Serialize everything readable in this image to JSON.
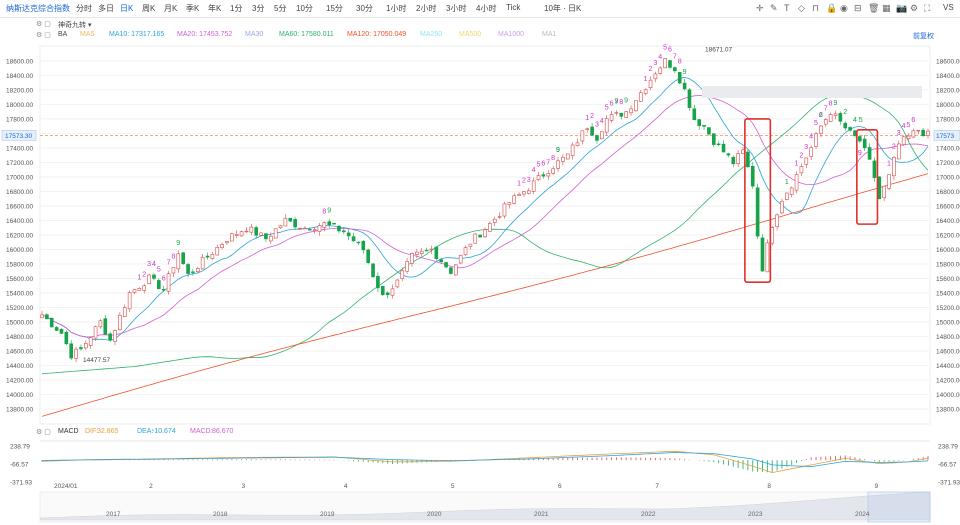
{
  "toolbar": {
    "title": "纳斯达克综合指数",
    "periods": [
      "分时",
      "多日",
      "日K",
      "周K",
      "月K",
      "季K",
      "年K",
      "1分",
      "3分",
      "5分",
      "10分",
      "15分",
      "30分",
      "1小时",
      "2小时",
      "3小时",
      "4小时",
      "Tick",
      "10年 · 日K"
    ],
    "active_period": "日K",
    "right_label": "VS",
    "icons": [
      "crosshair-icon",
      "draw-icon",
      "text-icon",
      "shape-icon",
      "magnet-icon",
      "lock-icon",
      "eye-icon",
      "ruler-icon",
      "trash-icon",
      "layout-icon",
      "camera-icon",
      "settings-icon",
      "fullscreen-icon"
    ]
  },
  "legend": {
    "strategy_label": "神奇九转",
    "ba_label": "BA",
    "mas": [
      {
        "label": "MA5",
        "value": "",
        "color": "#e8b86a"
      },
      {
        "label": "MA10",
        "value": "17317.165",
        "color": "#2ba3d9"
      },
      {
        "label": "MA20",
        "value": "17453.752",
        "color": "#d35fd3"
      },
      {
        "label": "MA30",
        "value": "",
        "color": "#9aa4e8"
      },
      {
        "label": "MA60",
        "value": "17580.011",
        "color": "#2fb36b"
      },
      {
        "label": "MA120",
        "value": "17050.049",
        "color": "#f0502a"
      },
      {
        "label": "MA250",
        "value": "",
        "color": "#8fe6f0"
      },
      {
        "label": "MA500",
        "value": "",
        "color": "#e8d86a"
      },
      {
        "label": "MA1000",
        "value": "",
        "color": "#c9a0e8"
      },
      {
        "label": "MA1",
        "value": "",
        "color": "#bbbbbb"
      }
    ],
    "right_link": "前复权"
  },
  "macd_legend": {
    "name": "MACD",
    "dif_label": "DIF:",
    "dif_value": "32.865",
    "dea_label": "DEA:",
    "dea_value": "-10.674",
    "macd_label": "MACD:",
    "macd_value": "86.670"
  },
  "current_price": "17573.30",
  "annotations": {
    "high": "18671.07",
    "low": "14477.57"
  },
  "chart_data": {
    "type": "candlestick",
    "y_ticks": [
      "18600.00",
      "18400.00",
      "18200.00",
      "18000.00",
      "17800.00",
      "17600.00",
      "17400.00",
      "17200.00",
      "17000.00",
      "16800.00",
      "16600.00",
      "16400.00",
      "16200.00",
      "16000.00",
      "15800.00",
      "15600.00",
      "15400.00",
      "15200.00",
      "15000.00",
      "14800.00",
      "14600.00",
      "14400.00",
      "14200.00",
      "14000.00",
      "13800.00"
    ],
    "ylim": [
      13650,
      18750
    ],
    "macd_ticks": [
      "238.79",
      "-66.57",
      "-371.93"
    ],
    "macd_ylim": [
      -420,
      290
    ],
    "month_labels": [
      {
        "label": "2024/01",
        "index": 0
      },
      {
        "label": "2",
        "index": 22
      },
      {
        "label": "3",
        "index": 41
      },
      {
        "label": "4",
        "index": 62
      },
      {
        "label": "5",
        "index": 84
      },
      {
        "label": "6",
        "index": 106
      },
      {
        "label": "7",
        "index": 126
      },
      {
        "label": "8",
        "index": 149
      },
      {
        "label": "9",
        "index": 171
      }
    ],
    "years": [
      "2017",
      "2018",
      "2019",
      "2020",
      "2021",
      "2022",
      "2023",
      "2024"
    ],
    "anchors": [
      [
        0,
        15100
      ],
      [
        4,
        14850
      ],
      [
        6,
        14550
      ],
      [
        8,
        14620
      ],
      [
        12,
        15000
      ],
      [
        14,
        14750
      ],
      [
        18,
        15400
      ],
      [
        22,
        15600
      ],
      [
        25,
        15450
      ],
      [
        28,
        15950
      ],
      [
        30,
        15650
      ],
      [
        34,
        15900
      ],
      [
        38,
        16150
      ],
      [
        42,
        16300
      ],
      [
        46,
        16150
      ],
      [
        50,
        16400
      ],
      [
        54,
        16300
      ],
      [
        58,
        16350
      ],
      [
        62,
        16250
      ],
      [
        66,
        16000
      ],
      [
        68,
        15650
      ],
      [
        70,
        15350
      ],
      [
        73,
        15550
      ],
      [
        76,
        15900
      ],
      [
        80,
        16000
      ],
      [
        84,
        15700
      ],
      [
        88,
        16100
      ],
      [
        92,
        16350
      ],
      [
        96,
        16650
      ],
      [
        100,
        16850
      ],
      [
        104,
        17100
      ],
      [
        108,
        17300
      ],
      [
        112,
        17700
      ],
      [
        114,
        17550
      ],
      [
        116,
        17800
      ],
      [
        120,
        17900
      ],
      [
        124,
        18250
      ],
      [
        126,
        18450
      ],
      [
        128,
        18600
      ],
      [
        130,
        18500
      ],
      [
        132,
        18200
      ],
      [
        134,
        17800
      ],
      [
        136,
        17700
      ],
      [
        138,
        17500
      ],
      [
        140,
        17350
      ],
      [
        142,
        17200
      ],
      [
        144,
        17350
      ],
      [
        146,
        16900
      ],
      [
        147,
        16200
      ],
      [
        148,
        15750
      ],
      [
        150,
        16350
      ],
      [
        152,
        16700
      ],
      [
        154,
        16900
      ],
      [
        156,
        17150
      ],
      [
        158,
        17400
      ],
      [
        160,
        17700
      ],
      [
        162,
        17900
      ],
      [
        164,
        17750
      ],
      [
        166,
        17600
      ],
      [
        168,
        17500
      ],
      [
        170,
        17200
      ],
      [
        171,
        17000
      ],
      [
        172,
        16700
      ],
      [
        174,
        17000
      ],
      [
        176,
        17450
      ],
      [
        178,
        17550
      ],
      [
        180,
        17650
      ],
      [
        182,
        17580
      ]
    ],
    "macd_series": {
      "dif": [
        [
          0,
          -20
        ],
        [
          10,
          10
        ],
        [
          22,
          20
        ],
        [
          40,
          45
        ],
        [
          60,
          55
        ],
        [
          72,
          -30
        ],
        [
          84,
          -20
        ],
        [
          100,
          40
        ],
        [
          118,
          110
        ],
        [
          130,
          150
        ],
        [
          138,
          90
        ],
        [
          146,
          -100
        ],
        [
          150,
          -210
        ],
        [
          158,
          -80
        ],
        [
          165,
          30
        ],
        [
          172,
          -60
        ],
        [
          178,
          -30
        ],
        [
          182,
          33
        ]
      ],
      "dea": [
        [
          0,
          -5
        ],
        [
          10,
          5
        ],
        [
          22,
          15
        ],
        [
          40,
          35
        ],
        [
          60,
          50
        ],
        [
          72,
          10
        ],
        [
          84,
          -10
        ],
        [
          100,
          20
        ],
        [
          118,
          80
        ],
        [
          130,
          130
        ],
        [
          138,
          110
        ],
        [
          146,
          20
        ],
        [
          150,
          -80
        ],
        [
          158,
          -110
        ],
        [
          165,
          -20
        ],
        [
          172,
          -40
        ],
        [
          178,
          -30
        ],
        [
          182,
          -11
        ]
      ]
    },
    "nine_turns": [
      {
        "i": 20,
        "labels": [
          "1",
          "2",
          "3",
          "4",
          "5",
          "6",
          "7",
          "8",
          "9"
        ],
        "color": "#cc33cc",
        "dir": "up"
      },
      {
        "i": 98,
        "labels": [
          "1",
          "2",
          "3",
          "4",
          "5",
          "6",
          "7",
          "8",
          "9"
        ],
        "color": "#cc33cc",
        "dir": "up"
      },
      {
        "i": 112,
        "labels": [
          "1",
          "2",
          "3",
          "4",
          "5",
          "6",
          "7",
          "8",
          "9"
        ],
        "color": "#cc33cc",
        "dir": "up"
      },
      {
        "i": 124,
        "labels": [
          "1",
          "2",
          "3",
          "4",
          "5",
          "6",
          "7",
          "8",
          "9"
        ],
        "color": "#cc33cc",
        "dir": "up"
      },
      {
        "i": 155,
        "labels": [
          "1",
          "2",
          "3",
          "4",
          "5",
          "6",
          "7",
          "8",
          "9"
        ],
        "color": "#cc33cc",
        "dir": "up"
      },
      {
        "i": 174,
        "labels": [
          "1",
          "2",
          "3",
          "4",
          "5",
          "6"
        ],
        "color": "#cc33cc",
        "dir": "up"
      },
      {
        "i": 58,
        "labels": [
          "8",
          "9"
        ],
        "color": "#cc33cc",
        "dir": "up"
      },
      {
        "i": 168,
        "labels": [
          "9"
        ],
        "color": "#cc33cc",
        "dir": "down"
      }
    ],
    "green_nines": [
      {
        "i": 106,
        "label": "9"
      },
      {
        "i": 118,
        "label": "9"
      },
      {
        "i": 153,
        "label": "1"
      },
      {
        "i": 160,
        "label": "2"
      },
      {
        "i": 165,
        "label": "2"
      },
      {
        "i": 167,
        "label": "4 5"
      }
    ],
    "highlight_boxes": [
      {
        "from": 145,
        "to": 149,
        "ymin": 15550,
        "ymax": 17800
      },
      {
        "from": 168,
        "to": 171,
        "ymin": 16350,
        "ymax": 17650
      }
    ]
  }
}
